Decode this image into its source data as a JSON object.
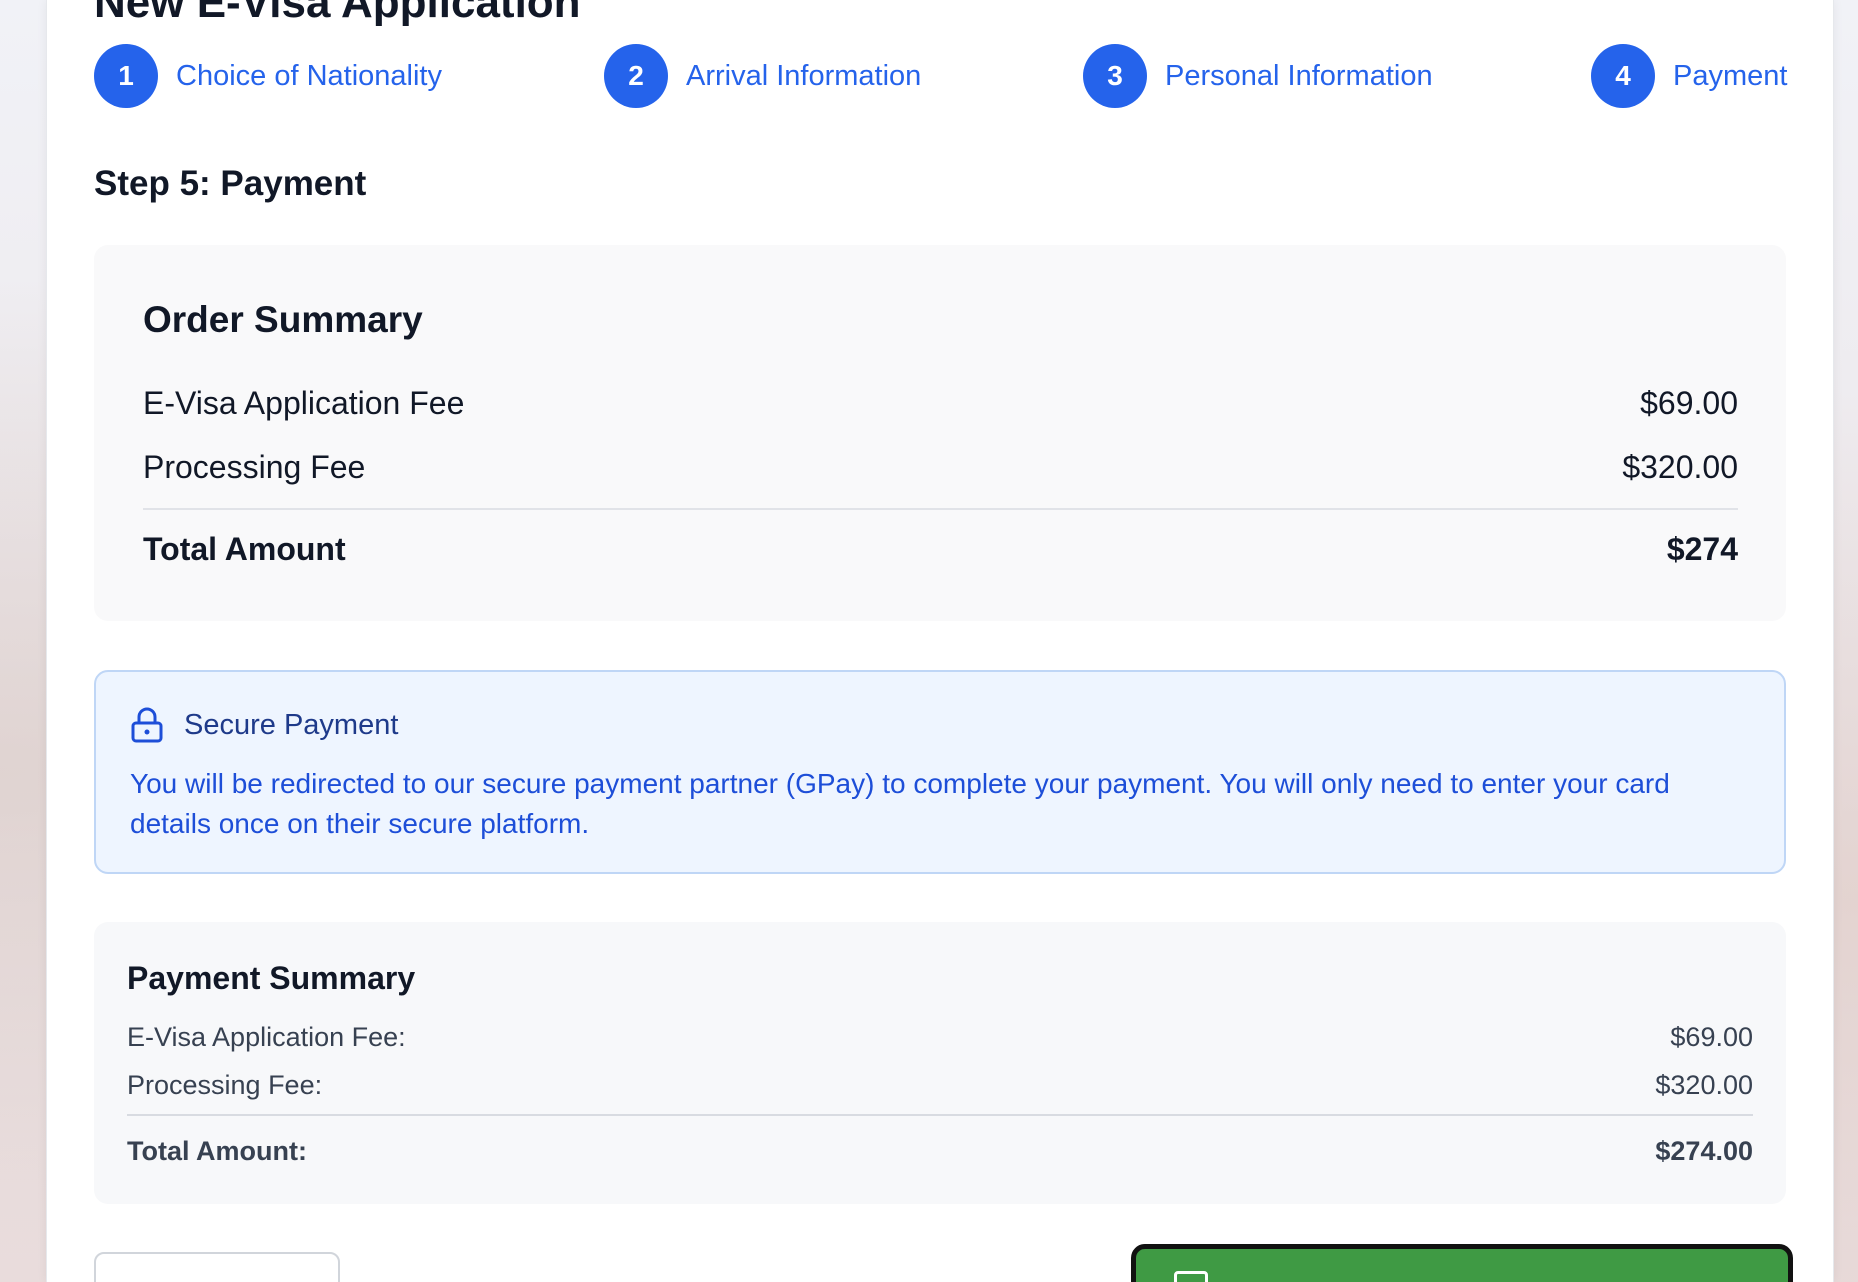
{
  "page": {
    "title": "New E-Visa Application",
    "step_heading": "Step 5: Payment"
  },
  "stepper": [
    {
      "number": "1",
      "label": "Choice of Nationality"
    },
    {
      "number": "2",
      "label": "Arrival Information"
    },
    {
      "number": "3",
      "label": "Personal Information"
    },
    {
      "number": "4",
      "label": "Payment"
    }
  ],
  "order_summary": {
    "title": "Order Summary",
    "rows": [
      {
        "label": "E-Visa Application Fee",
        "value": "$69.00"
      },
      {
        "label": "Processing Fee",
        "value": "$320.00"
      }
    ],
    "total": {
      "label": "Total Amount",
      "value": "$274"
    }
  },
  "secure_payment": {
    "icon": "lock-icon",
    "title": "Secure Payment",
    "text": "You will be redirected to our secure payment partner (GPay) to complete your payment. You will only need to enter your card details once on their secure platform."
  },
  "payment_summary": {
    "title": "Payment Summary",
    "rows": [
      {
        "label": "E-Visa Application Fee:",
        "value": "$69.00"
      },
      {
        "label": "Processing Fee:",
        "value": "$320.00"
      }
    ],
    "total": {
      "label": "Total Amount:",
      "value": "$274.00"
    }
  },
  "colors": {
    "primary": "#2563eb",
    "secure_bg": "#eef5ff",
    "secure_text": "#1d4ed8",
    "submit_green": "#3f9a44"
  }
}
